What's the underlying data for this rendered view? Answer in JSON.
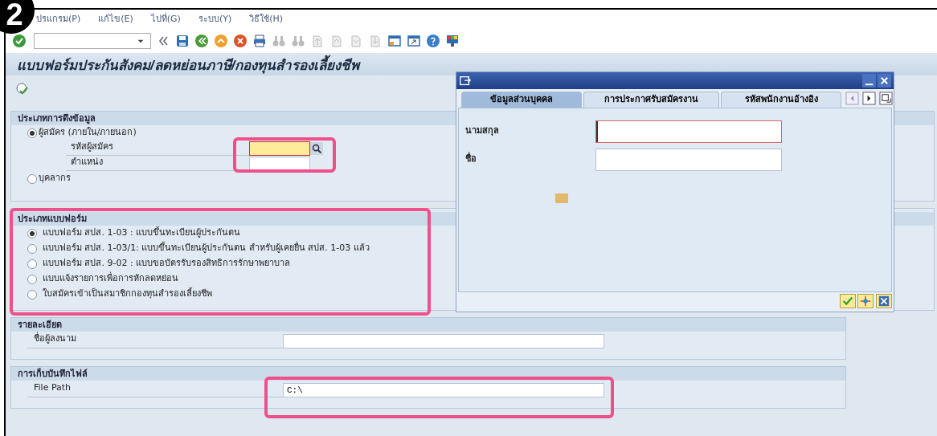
{
  "step_badge": "2",
  "menu": [
    "ปรแกรม(P)",
    "แก้ไข(E)",
    "ไปที่(G)",
    "ระบบ(Y)",
    "วิธีใช้(H)"
  ],
  "screen_title": "แบบฟอร์มประกันสังคม/ลดหย่อนภาษี/กองทุนสำรองเลี้ยงชีพ",
  "data_source": {
    "title": "ประเภทการดึงข้อมูล",
    "options": [
      {
        "label": "ผู้สมัคร (ภายใน/ภายนอก)",
        "selected": true,
        "fields": [
          {
            "label": "รหัสผู้สมัคร",
            "kind": "lookup"
          },
          {
            "label": "ตำแหน่ง",
            "kind": "text"
          }
        ]
      },
      {
        "label": "บุคลากร",
        "selected": false
      }
    ]
  },
  "form_type": {
    "title": "ประเภทแบบฟอร์ม",
    "options": [
      {
        "label": "แบบฟอร์ม สปส. 1-03 : แบบขึ้นทะเบียนผู้ประกันตน",
        "selected": true
      },
      {
        "label": "แบบฟอร์ม สปส. 1-03/1: แบบขึ้นทะเบียนผู้ประกันตน สำหรับผู้เคยยื่น สปส. 1-03 แล้ว",
        "selected": false
      },
      {
        "label": "แบบฟอร์ม สปส. 9-02 : แบบขอบัตรรับรองสิทธิการรักษาพยาบาล",
        "selected": false
      },
      {
        "label": "แบบแจ้งรายการเพื่อการหักลดหย่อน",
        "selected": false
      },
      {
        "label": "ใบสมัครเข้าเป็นสมาชิกกองทุนสำรองเลี้ยงชีพ",
        "selected": false
      }
    ]
  },
  "details": {
    "title": "รายละเอียด",
    "fields": [
      {
        "label": "ชื่อผู้ลงนาม"
      }
    ]
  },
  "file_storage": {
    "title": "การเก็บบันทึกไฟล์",
    "fields": [
      {
        "label": "File Path",
        "value": "C:\\"
      }
    ]
  },
  "dialog": {
    "tabs": [
      {
        "label": "ข้อมูลส่วนบุคคล",
        "selected": true
      },
      {
        "label": "การประกาศรับสมัครงาน",
        "selected": false
      },
      {
        "label": "รหัสพนักงานอ้างอิง",
        "selected": false
      }
    ],
    "fields": [
      {
        "label": "นามสกุล",
        "focused": true
      },
      {
        "label": "ชื่อ",
        "focused": false
      }
    ]
  }
}
